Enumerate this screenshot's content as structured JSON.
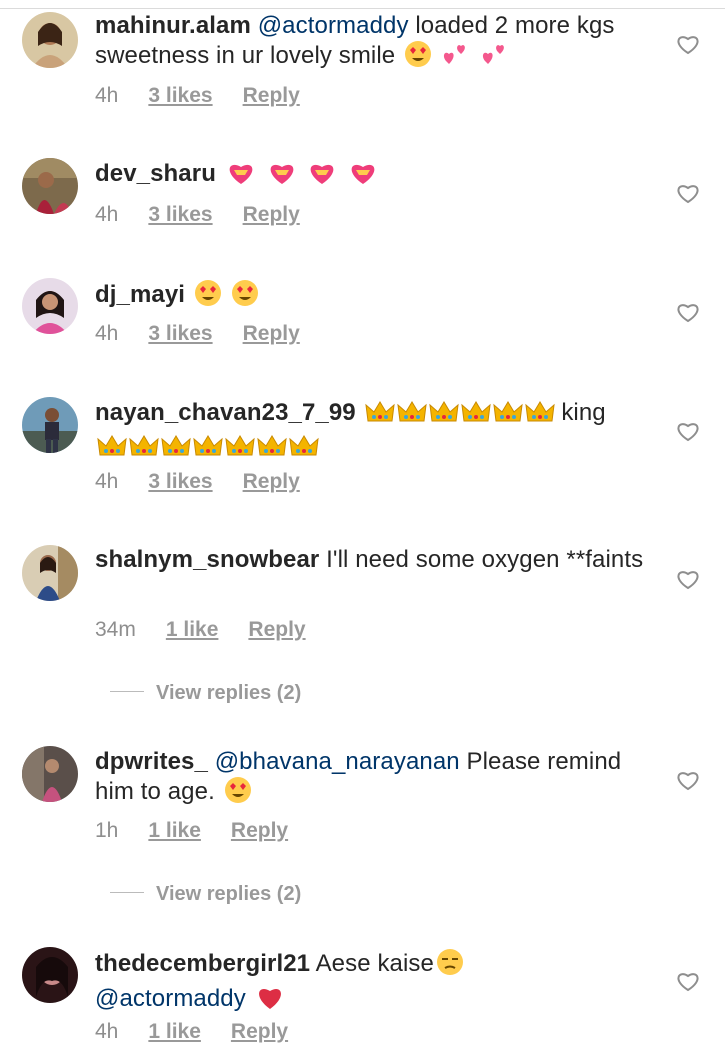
{
  "comments": [
    {
      "username": "mahinur.alam",
      "mention": "@actormaddy",
      "text": " loaded 2 more kgs sweetness in ur lovely smile",
      "emojis": [
        "heart-eyes",
        "two-hearts",
        "two-hearts"
      ],
      "time": "4h",
      "likes": "3 likes",
      "reply": "Reply"
    },
    {
      "username": "dev_sharu",
      "text": "",
      "emojis": [
        "heart-ribbon",
        "heart-ribbon",
        "heart-ribbon",
        "heart-ribbon"
      ],
      "time": "4h",
      "likes": "3 likes",
      "reply": "Reply"
    },
    {
      "username": "dj_mayi",
      "text": "",
      "emojis": [
        "heart-eyes",
        "heart-eyes"
      ],
      "time": "4h",
      "likes": "3 likes",
      "reply": "Reply"
    },
    {
      "username": "nayan_chavan23_7_99",
      "text_after": "king",
      "emojis": [
        "crown",
        "crown",
        "crown",
        "crown",
        "crown",
        "crown",
        "crown",
        "crown",
        "crown",
        "crown",
        "crown",
        "crown",
        "crown"
      ],
      "time": "4h",
      "likes": "3 likes",
      "reply": "Reply"
    },
    {
      "username": "shalnym_snowbear",
      "text": " I'll need some oxygen **faints",
      "time": "34m",
      "likes": "1 like",
      "reply": "Reply",
      "view_replies": "View replies (2)"
    },
    {
      "username": "dpwrites_",
      "mention": "@bhavana_narayanan",
      "text": " Please remind him to age.",
      "emojis": [
        "heart-eyes"
      ],
      "time": "1h",
      "likes": "1 like",
      "reply": "Reply",
      "view_replies": "View replies (2)"
    },
    {
      "username": "thedecembergirl21",
      "text": " Aese kaise",
      "mention": "@actormaddy",
      "emojis": [
        "unamused-face",
        "red-heart"
      ],
      "time": "4h",
      "likes": "1 like",
      "reply": "Reply"
    }
  ],
  "colors": {
    "text": "#262626",
    "meta": "#8e8e8e",
    "mention": "#003569",
    "divider": "#dbdbdb"
  }
}
